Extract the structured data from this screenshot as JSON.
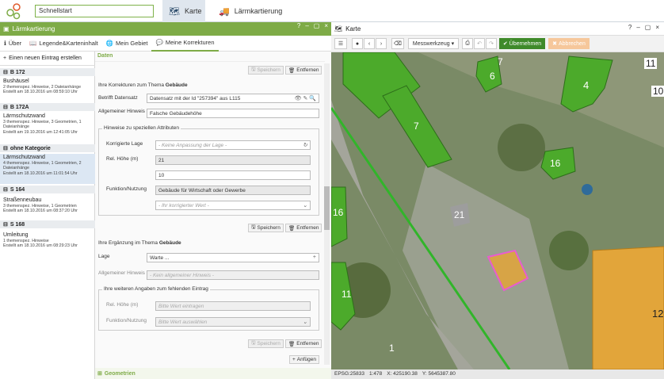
{
  "top": {
    "search_value": "Schnellstart",
    "tabs": [
      {
        "label": "Karte",
        "icon": "map-icon"
      },
      {
        "label": "Lärmkartierung",
        "icon": "truck-icon"
      }
    ]
  },
  "left_panel": {
    "title": "Lärmkartierung",
    "controls": [
      "?",
      "–",
      "▢",
      "×"
    ],
    "tabs": [
      {
        "label": "Über",
        "icon": "info-icon"
      },
      {
        "label": "Legende&Karteninhalt",
        "icon": "book-icon"
      },
      {
        "label": "Mein Gebiet",
        "icon": "globe-icon"
      },
      {
        "label": "Meine Korrekturen",
        "icon": "comment-icon"
      }
    ],
    "new_entry": "Einen neuen Eintrag erstellen",
    "groups": [
      {
        "name": "B 172",
        "items": [
          {
            "title": "Bushäusel",
            "line1": "2 themenspez. Hinweise, 2 Dateianhänge",
            "line2": "Erstellt am 18.10.2016 um 08:59:10 Uhr"
          }
        ]
      },
      {
        "name": "B 172A",
        "items": [
          {
            "title": "Lärmschutzwand",
            "line1": "3 themenspez. Hinweise, 3 Geometrien, 1 Dateianhänge",
            "line2": "Erstellt am 19.10.2016 um 12:41:05 Uhr"
          }
        ]
      },
      {
        "name": "ohne Kategorie",
        "items": [
          {
            "title": "Lärmschutzwand",
            "line1": "4 themenspez. Hinweise, 1 Geometrien, 2 Dateianhänge",
            "line2": "Erstellt am 18.10.2016 um 11:01:54 Uhr"
          }
        ]
      },
      {
        "name": "S 164",
        "items": [
          {
            "title": "Straßenneubau",
            "line1": "3 themenspez. Hinweise, 1 Geometrien",
            "line2": "Erstellt am 18.10.2016 um 08:37:20 Uhr"
          }
        ]
      },
      {
        "name": "S 168",
        "items": [
          {
            "title": "Umleitung",
            "line1": "1 themenspez. Hinweise",
            "line2": "Erstellt am 18.10.2016 um 08:29:23 Uhr"
          }
        ]
      }
    ]
  },
  "detail": {
    "header": "Daten",
    "save": "Speichern",
    "remove": "Entfernen",
    "corr_title": "Ihre Korrekturen zum Thema",
    "corr_theme": "Gebäude",
    "betrifft_label": "Betrifft Datensatz",
    "betrifft_value": "Datensatz mit der Id \"257394\" aus L115",
    "hinweis_label": "Allgemeiner Hinweis",
    "hinweis_value": "Falsche Gebäudehöhe",
    "attr_section": "Hinweise zu speziellen Attributen",
    "lage_label": "Korrigierte Lage",
    "lage_value": "- Keine Anpassung der Lage -",
    "hoehe_label": "Rel. Höhe (m)",
    "hoehe_old": "21",
    "hoehe_new": "10",
    "funktion_label": "Funktion/Nutzung",
    "funktion_old": "Gebäude für Wirtschaft oder Gewerbe",
    "funktion_new": "- Ihr korrigierter Wert -",
    "erg_title": "Ihre Ergänzung im Thema",
    "erg_theme": "Gebäude",
    "erg_lage_label": "Lage",
    "erg_lage_value": "Warte ...",
    "erg_hinweis_label": "Allgemeiner Hinweis",
    "erg_hinweis_value": "- Kein allgemeiner Hinweis -",
    "erg_section": "Ihre weiteren Angaben zum fehlenden Eintrag",
    "erg_hoehe_label": "Rel. Höhe (m)",
    "erg_hoehe_value": "Bitte Wert eintragen",
    "erg_funktion_label": "Funktion/Nutzung",
    "erg_funktion_value": "Bitte Wert auswählen",
    "add": "Anfügen",
    "geometrien": "Geometrien"
  },
  "map_panel": {
    "title": "Karte",
    "controls": [
      "?",
      "–",
      "▢",
      "×"
    ],
    "measure_tool": "Messwerkzeug",
    "apply": "Übernehmen",
    "cancel": "Abbrechen",
    "building_numbers": [
      "7",
      "6",
      "4",
      "11",
      "10",
      "7",
      "16",
      "21",
      "16",
      "11",
      "1",
      "12"
    ],
    "status": {
      "epsg": "EPSG:25833",
      "scale": "1:478",
      "x": "X: 425190.38",
      "y": "Y: 5645387.80"
    }
  },
  "colors": {
    "accent": "#7eab47",
    "building": "#4caa2b",
    "selected": "#e2a53a",
    "highlight": "#e85cd0"
  }
}
